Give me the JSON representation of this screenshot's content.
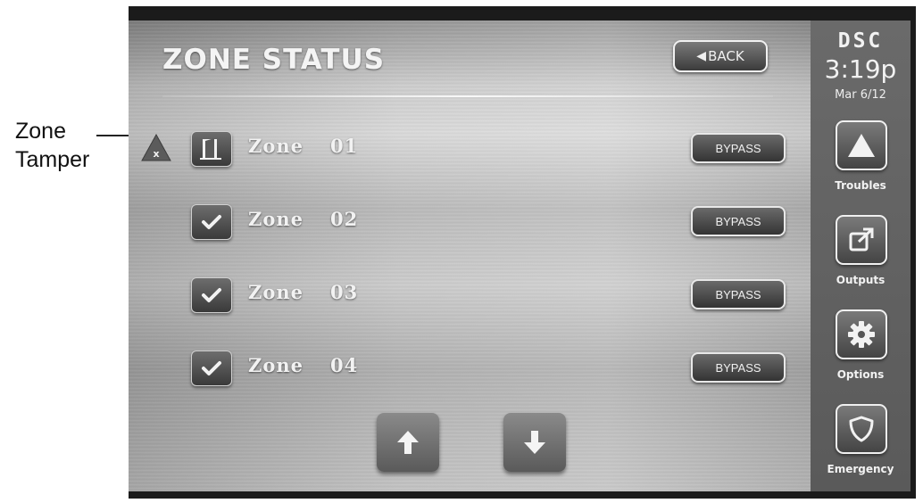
{
  "callout": {
    "label_line1": "Zone",
    "label_line2": "Tamper"
  },
  "header": {
    "title": "ZONE STATUS",
    "back_label": "BACK"
  },
  "zones": [
    {
      "label": "Zone",
      "number": "01",
      "status_icon": "door-open-icon",
      "tamper": true,
      "bypass_label": "BYPASS"
    },
    {
      "label": "Zone",
      "number": "02",
      "status_icon": "checkmark-icon",
      "tamper": false,
      "bypass_label": "BYPASS"
    },
    {
      "label": "Zone",
      "number": "03",
      "status_icon": "checkmark-icon",
      "tamper": false,
      "bypass_label": "BYPASS"
    },
    {
      "label": "Zone",
      "number": "04",
      "status_icon": "checkmark-icon",
      "tamper": false,
      "bypass_label": "BYPASS"
    }
  ],
  "sidebar": {
    "brand": "DSC",
    "time": "3:19p",
    "date": "Mar 6/12",
    "items": [
      {
        "label": "Troubles",
        "icon": "warning-icon"
      },
      {
        "label": "Outputs",
        "icon": "external-link-icon"
      },
      {
        "label": "Options",
        "icon": "gear-icon"
      },
      {
        "label": "Emergency",
        "icon": "shield-icon"
      }
    ]
  },
  "colors": {
    "frame": "#1b1b1b",
    "sidebar": "#636363",
    "text": "#f2f2f2"
  }
}
